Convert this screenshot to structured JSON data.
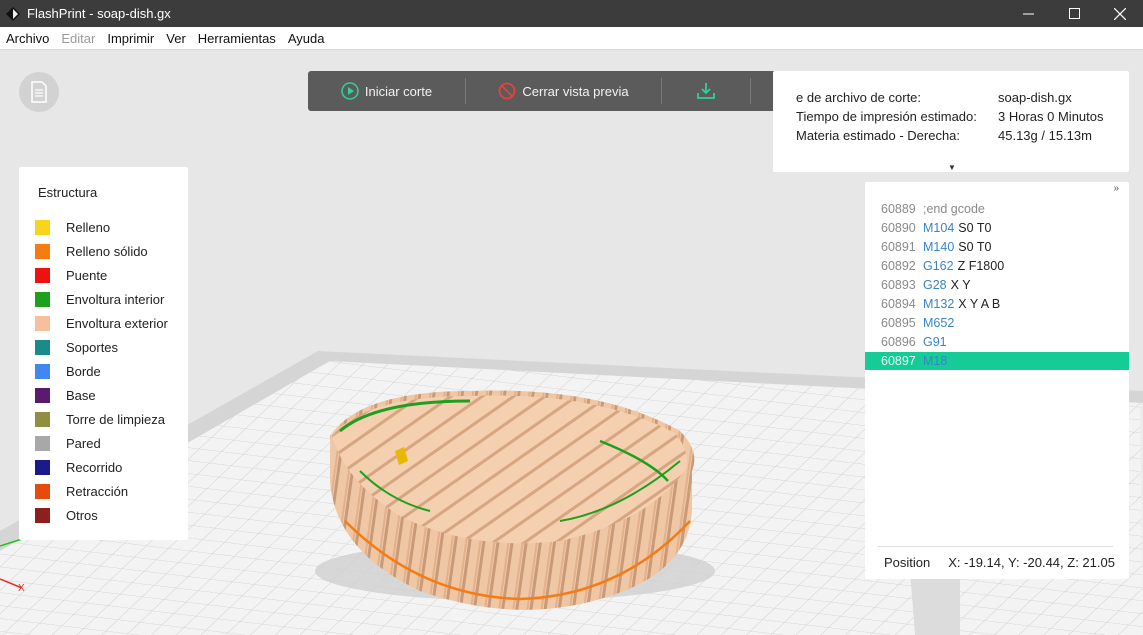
{
  "window": {
    "title": "FlashPrint - soap-dish.gx",
    "controls": [
      "minimize",
      "maximize",
      "close"
    ]
  },
  "menu": [
    "Archivo",
    "Editar",
    "Imprimir",
    "Ver",
    "Herramientas",
    "Ayuda"
  ],
  "toolbar": {
    "start_slice": "Iniciar corte",
    "close_preview": "Cerrar vista previa"
  },
  "info": {
    "file_label": "e de archivo de corte:",
    "file_value": "soap-dish.gx",
    "time_label": "Tiempo de impresión estimado:",
    "time_value": "3 Horas 0 Minutos",
    "material_label": "Materia estimado - Derecha:",
    "material_value": "45.13g / 15.13m"
  },
  "legend": {
    "title": "Estructura",
    "items": [
      {
        "label": "Relleno",
        "color": "#f8d41c"
      },
      {
        "label": "Relleno sólido",
        "color": "#f57c12"
      },
      {
        "label": "Puente",
        "color": "#ee1111"
      },
      {
        "label": "Envoltura interior",
        "color": "#1ea01e"
      },
      {
        "label": "Envoltura exterior",
        "color": "#f6c09c"
      },
      {
        "label": "Soportes",
        "color": "#1a8a8a"
      },
      {
        "label": "Borde",
        "color": "#4287f0"
      },
      {
        "label": "Base",
        "color": "#5a1a6e"
      },
      {
        "label": "Torre de limpieza",
        "color": "#8f8f44"
      },
      {
        "label": "Pared",
        "color": "#a8a8a8"
      },
      {
        "label": "Recorrido",
        "color": "#1a1a8a"
      },
      {
        "label": "Retracción",
        "color": "#e64a0c"
      },
      {
        "label": "Otros",
        "color": "#8c2020"
      }
    ]
  },
  "gcode": {
    "lines": [
      {
        "n": "60889",
        "cmd": "",
        "args": ";end gcode"
      },
      {
        "n": "60890",
        "cmd": "M104",
        "args": "S0 T0"
      },
      {
        "n": "60891",
        "cmd": "M140",
        "args": "S0 T0"
      },
      {
        "n": "60892",
        "cmd": "G162",
        "args": "Z F1800"
      },
      {
        "n": "60893",
        "cmd": "G28",
        "args": "X Y"
      },
      {
        "n": "60894",
        "cmd": "M132",
        "args": "X Y A B"
      },
      {
        "n": "60895",
        "cmd": "M652",
        "args": ""
      },
      {
        "n": "60896",
        "cmd": "G91",
        "args": ""
      },
      {
        "n": "60897",
        "cmd": "M18",
        "args": ""
      }
    ],
    "active_index": 8,
    "position_label": "Position",
    "position_value": "X: -19.14, Y: -20.44, Z: 21.05"
  },
  "axis_label": "X",
  "colors": {
    "titlebar": "#3c3c3c",
    "toolbar": "#5b5b5b",
    "accent_green": "#16cc96",
    "gcode_command": "#3a84c6"
  }
}
